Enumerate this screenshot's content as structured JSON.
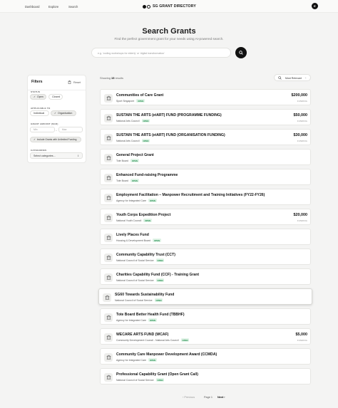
{
  "nav": {
    "links": [
      "Dashboard",
      "Explore",
      "Search"
    ],
    "brand": "SG GRANT DIRECTORY",
    "avatar_letter": "E"
  },
  "hero": {
    "title": "Search Grants",
    "subtitle": "Find the perfect government grant for your needs using AI-powered search.",
    "search_placeholder": "e.g. 'coding workshops for elderly' or 'digital transformation'"
  },
  "filters": {
    "title": "Filters",
    "reset": "Reset",
    "status_label": "STATUS",
    "status_open": "Open",
    "status_closed": "Closed",
    "applicable_label": "APPLICABLE TO",
    "applicable_individual": "Individual",
    "applicable_org": "Organisation",
    "amount_label": "GRANT AMOUNT (SGD)",
    "min_placeholder": "Min",
    "max_placeholder": "Max",
    "range_dash": "–",
    "include_unlimited": "Include Grants with Unlimited Funding",
    "categories_label": "CATEGORIES",
    "categories_select": "Select categories..."
  },
  "results": {
    "showing_prefix": "Showing",
    "count": "15",
    "showing_suffix": "results",
    "sort": "Most Relevant"
  },
  "funding_label": "FUNDING",
  "open_badge": "OPEN",
  "grants": [
    {
      "title": "Communities of Care Grant",
      "agency": "Sport Singapore",
      "amount": "$200,000"
    },
    {
      "title": "SUSTAIN THE ARTS (etART) FUND (PROGRAMME FUNDING)",
      "agency": "National Arts Council",
      "amount": "$50,000"
    },
    {
      "title": "SUSTAIN THE ARTS (etART) FUND (ORGANISATION FUNDING)",
      "agency": "National Arts Council",
      "amount": "$30,000"
    },
    {
      "title": "General Project Grant",
      "agency": "Tote Board",
      "amount": ""
    },
    {
      "title": "Enhanced Fund-raising Programme",
      "agency": "Tote Board",
      "amount": ""
    },
    {
      "title": "Employment Facilitation – Manpower Recruitment and Training Initiatives (FY22-FY26)",
      "agency": "Agency for Integrated Care",
      "amount": ""
    },
    {
      "title": "Youth Corps Expedition Project",
      "agency": "National Youth Council",
      "amount": "$20,000"
    },
    {
      "title": "Lively Places Fund",
      "agency": "Housing & Development Board",
      "amount": ""
    },
    {
      "title": "Community Capability Trust (CCT)",
      "agency": "National Council of Social Service",
      "amount": ""
    },
    {
      "title": "Charities Capability Fund (CCF) - Training Grant",
      "agency": "National Council of Social Service",
      "amount": ""
    },
    {
      "title": "SG60 Towards Sustainability Fund",
      "agency": "National Council of Social Service",
      "amount": ""
    },
    {
      "title": "Tote Board Better Health Fund (TBBHF)",
      "agency": "Agency for Integrated Care",
      "amount": ""
    },
    {
      "title": "WECARE ARTS FUND (WCAF)",
      "agency": "Community Development Council - National Arts Council",
      "amount": "$5,000"
    },
    {
      "title": "Community Care Manpower Development Award (CCMDA)",
      "agency": "Agency for Integrated Care",
      "amount": ""
    },
    {
      "title": "Professional Capability Grant (Open Grant Call)",
      "agency": "National Council of Social Service",
      "amount": ""
    }
  ],
  "pagination": {
    "previous": "Previous",
    "page": "Page 1",
    "next": "Next"
  }
}
